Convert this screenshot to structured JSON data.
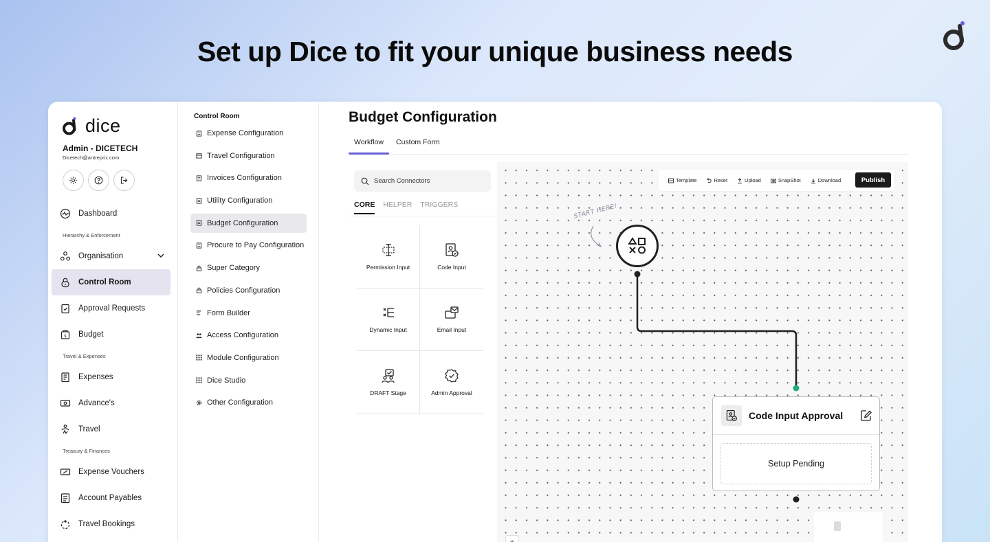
{
  "headline": "Set up Dice to fit your unique business needs",
  "brand": {
    "name": "dice",
    "accent": "#6a5cd6"
  },
  "user": {
    "name": "Admin - DICETECH",
    "email": "Dicetech@antrepriz.com"
  },
  "sidebar": {
    "icons": [
      "gear-icon",
      "help-icon",
      "logout-icon"
    ],
    "items": [
      {
        "type": "item",
        "label": "Dashboard",
        "icon": "dashboard-icon"
      },
      {
        "type": "section",
        "label": "Hierarchy & Enforcement"
      },
      {
        "type": "item",
        "label": "Organisation",
        "icon": "org-icon",
        "expandable": true
      },
      {
        "type": "item",
        "label": "Control Room",
        "icon": "lock-icon",
        "active": true
      },
      {
        "type": "item",
        "label": "Approval Requests",
        "icon": "clipboard-icon"
      },
      {
        "type": "item",
        "label": "Budget",
        "icon": "budget-icon"
      },
      {
        "type": "section",
        "label": "Travel & Expenses"
      },
      {
        "type": "item",
        "label": "Expenses",
        "icon": "receipt-icon"
      },
      {
        "type": "item",
        "label": "Advance's",
        "icon": "cash-icon"
      },
      {
        "type": "item",
        "label": "Travel",
        "icon": "travel-icon"
      },
      {
        "type": "section",
        "label": "Treasury & Finances"
      },
      {
        "type": "item",
        "label": "Expense Vouchers",
        "icon": "voucher-icon"
      },
      {
        "type": "item",
        "label": "Account Payables",
        "icon": "payables-icon"
      },
      {
        "type": "item",
        "label": "Travel Bookings",
        "icon": "booking-icon"
      }
    ]
  },
  "control_room": {
    "title": "Control Room",
    "items": [
      {
        "label": "Expense Configuration",
        "icon": "doc-icon"
      },
      {
        "label": "Travel Configuration",
        "icon": "calendar-icon"
      },
      {
        "label": "Invoices Configuration",
        "icon": "doc-icon"
      },
      {
        "label": "Utility Configuration",
        "icon": "doc-icon"
      },
      {
        "label": "Budget Configuration",
        "icon": "doc-icon",
        "active": true
      },
      {
        "label": "Procure to Pay Configuration",
        "icon": "doc-icon"
      },
      {
        "label": "Super Category",
        "icon": "lock-icon"
      },
      {
        "label": "Policies Configuration",
        "icon": "lock-icon"
      },
      {
        "label": "Form Builder",
        "icon": "form-icon"
      },
      {
        "label": "Access Configuration",
        "icon": "users-icon"
      },
      {
        "label": "Module Configuration",
        "icon": "grid-icon"
      },
      {
        "label": "Dice Studio",
        "icon": "grid-icon"
      },
      {
        "label": "Other Configuration",
        "icon": "gear-icon"
      }
    ]
  },
  "main": {
    "title": "Budget Configuration",
    "tabs": [
      {
        "label": "Workflow",
        "active": true
      },
      {
        "label": "Custom Form"
      }
    ]
  },
  "connectors": {
    "search_placeholder": "Search Connectors",
    "tabs": [
      {
        "label": "CORE",
        "active": true
      },
      {
        "label": "HELPER"
      },
      {
        "label": "TRIGGERS"
      }
    ],
    "items": [
      {
        "label": "Permission Input",
        "icon": "permission-icon"
      },
      {
        "label": "Code Input",
        "icon": "code-icon"
      },
      {
        "label": "Dynamic Input",
        "icon": "dynamic-icon"
      },
      {
        "label": "Email Input",
        "icon": "email-icon"
      },
      {
        "label": "DRAFT Stage",
        "icon": "draft-icon"
      },
      {
        "label": "Admin Approval",
        "icon": "approval-icon"
      }
    ]
  },
  "canvas": {
    "toolbar": [
      {
        "label": "Template",
        "icon": "template-icon"
      },
      {
        "label": "Reset",
        "icon": "reset-icon"
      },
      {
        "label": "Upload",
        "icon": "upload-icon"
      },
      {
        "label": "SnapShot",
        "icon": "camera-icon"
      },
      {
        "label": "Download",
        "icon": "download-icon"
      }
    ],
    "publish_label": "Publish",
    "start_hint": "START HERE!",
    "node": {
      "title": "Code Input Approval",
      "status": "Setup Pending"
    },
    "connector_color": "#1fae7a",
    "zoom_in": "+"
  }
}
